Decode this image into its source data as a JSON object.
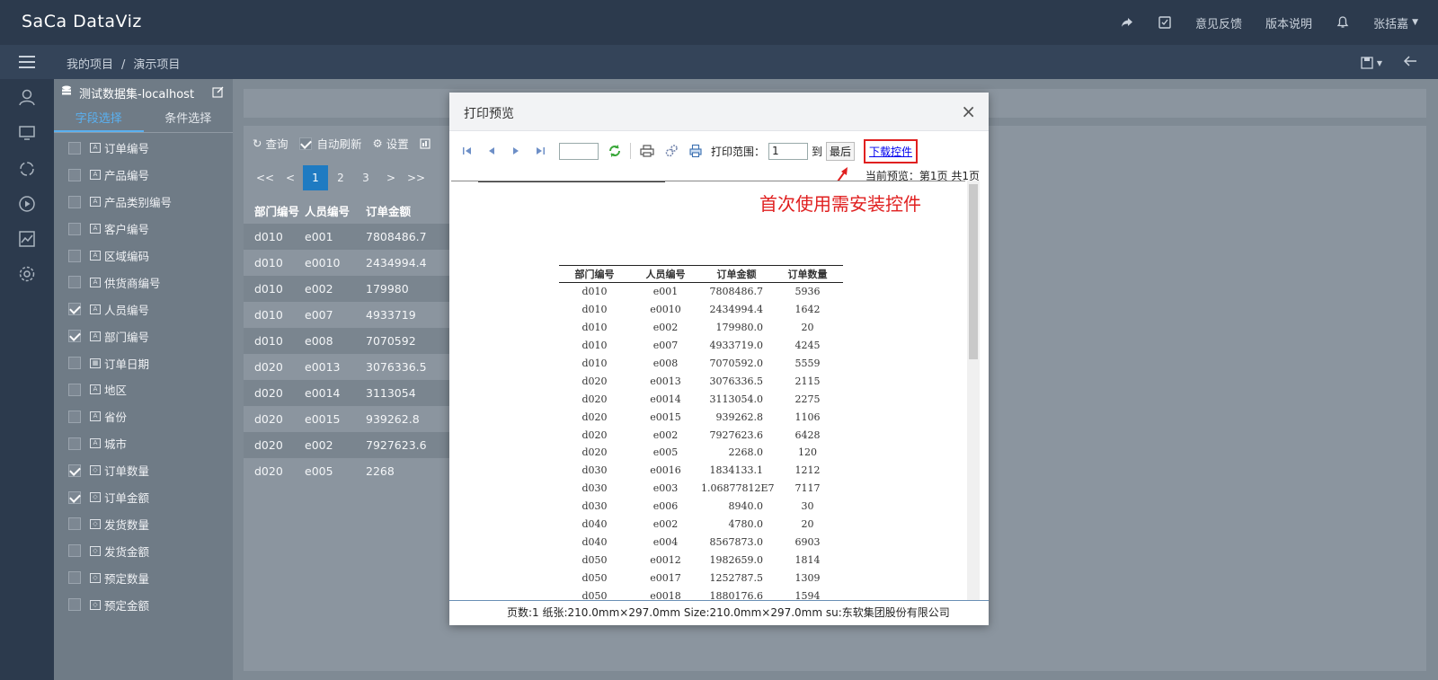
{
  "app": {
    "logo": "SaCa DataViz"
  },
  "topbar": {
    "feedback": "意见反馈",
    "version_notes": "版本说明",
    "user": "张括嘉"
  },
  "breadcrumb": {
    "root": "我的项目",
    "sep": "/",
    "current": "演示项目"
  },
  "field_panel": {
    "dataset": "测试数据集-localhost",
    "tabs": [
      "字段选择",
      "条件选择"
    ],
    "fields": [
      {
        "label": "订单编号",
        "checked": false,
        "type": "text"
      },
      {
        "label": "产品编号",
        "checked": false,
        "type": "text"
      },
      {
        "label": "产品类别编号",
        "checked": false,
        "type": "text"
      },
      {
        "label": "客户编号",
        "checked": false,
        "type": "text"
      },
      {
        "label": "区域编码",
        "checked": false,
        "type": "text"
      },
      {
        "label": "供货商编号",
        "checked": false,
        "type": "text"
      },
      {
        "label": "人员编号",
        "checked": true,
        "type": "text"
      },
      {
        "label": "部门编号",
        "checked": true,
        "type": "text"
      },
      {
        "label": "订单日期",
        "checked": false,
        "type": "date"
      },
      {
        "label": "地区",
        "checked": false,
        "type": "text"
      },
      {
        "label": "省份",
        "checked": false,
        "type": "text"
      },
      {
        "label": "城市",
        "checked": false,
        "type": "text"
      },
      {
        "label": "订单数量",
        "checked": true,
        "type": "measure"
      },
      {
        "label": "订单金额",
        "checked": true,
        "type": "measure"
      },
      {
        "label": "发货数量",
        "checked": false,
        "type": "measure"
      },
      {
        "label": "发货金额",
        "checked": false,
        "type": "measure"
      },
      {
        "label": "预定数量",
        "checked": false,
        "type": "measure"
      },
      {
        "label": "预定金额",
        "checked": false,
        "type": "measure"
      }
    ]
  },
  "main": {
    "toolbar": {
      "query": "查询",
      "auto_refresh": "自动刷新",
      "settings": "设置"
    },
    "pager": [
      "<<",
      "<",
      "1",
      "2",
      "3",
      ">",
      ">>"
    ],
    "table": {
      "headers": [
        "部门编号",
        "人员编号",
        "订单金额"
      ],
      "rows": [
        [
          "d010",
          "e001",
          "7808486.7"
        ],
        [
          "d010",
          "e0010",
          "2434994.4"
        ],
        [
          "d010",
          "e002",
          "179980"
        ],
        [
          "d010",
          "e007",
          "4933719"
        ],
        [
          "d010",
          "e008",
          "7070592"
        ],
        [
          "d020",
          "e0013",
          "3076336.5"
        ],
        [
          "d020",
          "e0014",
          "3113054"
        ],
        [
          "d020",
          "e0015",
          "939262.8"
        ],
        [
          "d020",
          "e002",
          "7927623.6"
        ],
        [
          "d020",
          "e005",
          "2268"
        ]
      ]
    }
  },
  "dialog": {
    "title": "打印预览",
    "close": "×",
    "print_range_label": "打印范围：",
    "range_from": "1",
    "to_label": "到",
    "last_label": "最后",
    "download_link": "下载控件",
    "current_preview": "当前预览：第1页 共1页",
    "annotation": "首次使用需安装控件",
    "preview_table": {
      "headers": [
        "部门编号",
        "人员编号",
        "订单金额",
        "订单数量"
      ],
      "rows": [
        [
          "d010",
          "e001",
          "7808486.7",
          "5936"
        ],
        [
          "d010",
          "e0010",
          "2434994.4",
          "1642"
        ],
        [
          "d010",
          "e002",
          "179980.0",
          "20"
        ],
        [
          "d010",
          "e007",
          "4933719.0",
          "4245"
        ],
        [
          "d010",
          "e008",
          "7070592.0",
          "5559"
        ],
        [
          "d020",
          "e0013",
          "3076336.5",
          "2115"
        ],
        [
          "d020",
          "e0014",
          "3113054.0",
          "2275"
        ],
        [
          "d020",
          "e0015",
          "939262.8",
          "1106"
        ],
        [
          "d020",
          "e002",
          "7927623.6",
          "6428"
        ],
        [
          "d020",
          "e005",
          "2268.0",
          "120"
        ],
        [
          "d030",
          "e0016",
          "1834133.1",
          "1212"
        ],
        [
          "d030",
          "e003",
          "1.06877812E7",
          "7117"
        ],
        [
          "d030",
          "e006",
          "8940.0",
          "30"
        ],
        [
          "d040",
          "e002",
          "4780.0",
          "20"
        ],
        [
          "d040",
          "e004",
          "8567873.0",
          "6903"
        ],
        [
          "d050",
          "e0012",
          "1982659.0",
          "1814"
        ],
        [
          "d050",
          "e0017",
          "1252787.5",
          "1309"
        ],
        [
          "d050",
          "e0018",
          "1880176.6",
          "1594"
        ]
      ]
    },
    "status_bar": "页数:1   纸张:210.0mm×297.0mm   Size:210.0mm×297.0mm   su:东软集团股份有限公司"
  }
}
